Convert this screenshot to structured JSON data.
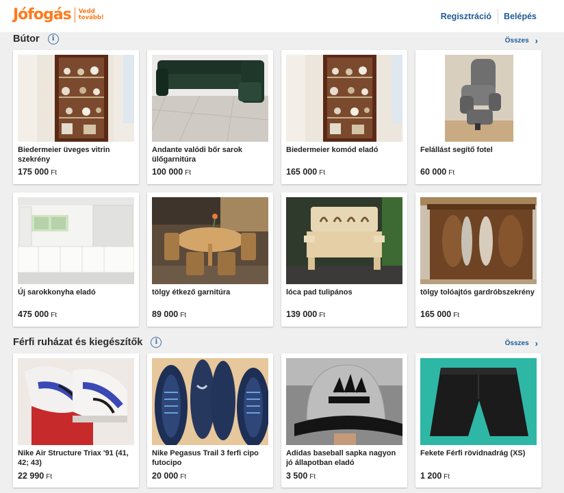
{
  "header": {
    "logo_word": "Jófogás",
    "logo_tag_line1": "Vedd",
    "logo_tag_line2": "tovább!",
    "register_label": "Regisztráció",
    "login_label": "Belépés",
    "brand_color": "#ff7a1a",
    "link_color": "#1e5a96"
  },
  "sections": [
    {
      "title": "Bútor",
      "see_all_label": "Összes",
      "items": [
        {
          "title": "Biedermeier üveges vitrin szekrény",
          "price": "175 000",
          "currency": "Ft",
          "image": "glass-cabinet"
        },
        {
          "title": "Andante valódi bőr sarok ülőgarnitúra",
          "price": "100 000",
          "currency": "Ft",
          "image": "leather-corner-sofa"
        },
        {
          "title": "Biedermeier komód eladó",
          "price": "165 000",
          "currency": "Ft",
          "image": "glass-cabinet"
        },
        {
          "title": "Felállást segítő fotel",
          "price": "60 000",
          "currency": "Ft",
          "image": "lift-chair"
        },
        {
          "title": "Új sarokkonyha eladó",
          "price": "475 000",
          "currency": "Ft",
          "image": "white-kitchen"
        },
        {
          "title": "tölgy étkező garnitúra",
          "price": "89 000",
          "currency": "Ft",
          "image": "dining-set"
        },
        {
          "title": "lóca pad tulipános",
          "price": "139 000",
          "currency": "Ft",
          "image": "wooden-bench"
        },
        {
          "title": "tölgy tolóajtós gardróbszekrény",
          "price": "165 000",
          "currency": "Ft",
          "image": "wardrobe"
        }
      ]
    },
    {
      "title": "Férfi ruházat és kiegészítők",
      "see_all_label": "Összes",
      "items": [
        {
          "title": "Nike Air Structure Triax '91 (41, 42; 43)",
          "price": "22 990",
          "currency": "Ft",
          "image": "sneakers-white"
        },
        {
          "title": "Nike Pegasus Trail 3 ferfi cipo futocipo",
          "price": "20 000",
          "currency": "Ft",
          "image": "sneakers-blue"
        },
        {
          "title": "Adidas baseball sapka nagyon jó állapotban eladó",
          "price": "3 500",
          "currency": "Ft",
          "image": "cap"
        },
        {
          "title": "Fekete Férfi rövidnadrág (XS)",
          "price": "1 200",
          "currency": "Ft",
          "image": "shorts"
        }
      ]
    }
  ]
}
